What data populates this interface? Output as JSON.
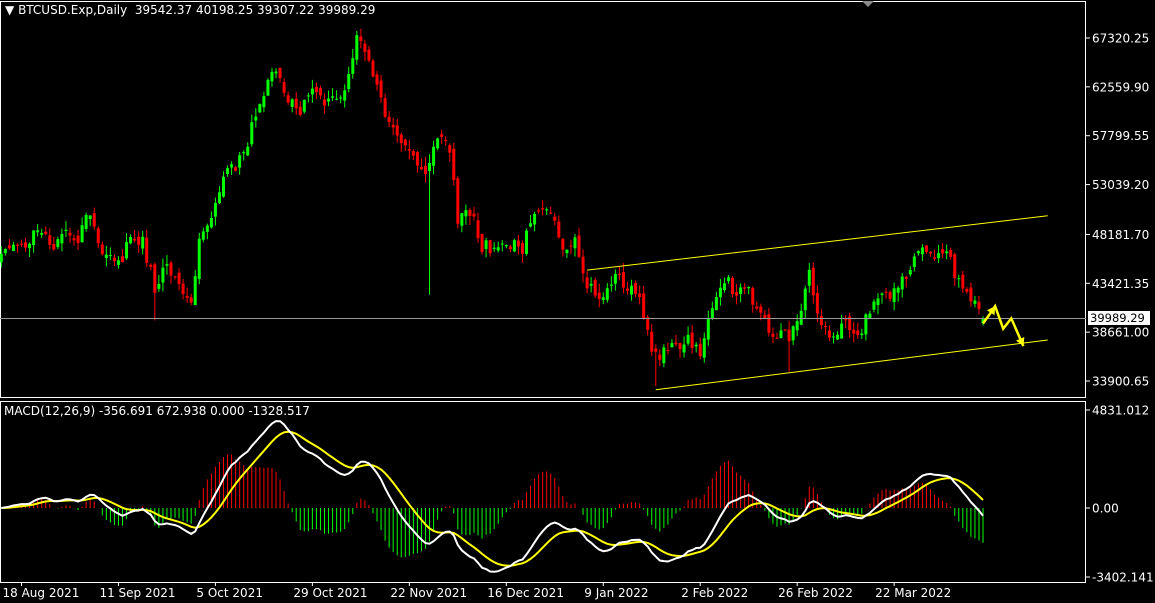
{
  "main_header": {
    "symbol": "BTCUSD.Exp,Daily",
    "ohlc": "39542.37 40198.25 39307.22 39989.29"
  },
  "macd_header": {
    "label": "MACD(12,26,9) -356.691 672.938 0.000 -1328.517"
  },
  "current_price": "39989.29",
  "colors": {
    "background": "#000000",
    "grid": "#ffffff",
    "bull": "#00ff00",
    "bear": "#ff0000",
    "channel": "#ffff00",
    "macd_line": "#ffffff",
    "signal_line": "#ffff00",
    "hist_pos": "#ff0000",
    "hist_neg": "#00ff00",
    "arrows": "#ffff00"
  },
  "icons": {
    "header_toggle": "triangle-down-icon"
  },
  "chart_data": [
    {
      "type": "candlestick",
      "title": "BTCUSD.Exp,Daily",
      "y_tick_labels": [
        "67320.25",
        "62559.90",
        "57799.55",
        "53039.20",
        "48181.70",
        "43421.35",
        "38661.00",
        "33900.65"
      ],
      "y_ticks": [
        67320.25,
        62559.9,
        57799.55,
        53039.2,
        48181.7,
        43421.35,
        38661.0,
        33900.65
      ],
      "x_tick_labels": [
        "18 Aug 2021",
        "11 Sep 2021",
        "5 Oct 2021",
        "29 Oct 2021",
        "22 Nov 2021",
        "16 Dec 2021",
        "9 Jan 2022",
        "2 Feb 2022",
        "26 Feb 2022",
        "22 Mar 2022"
      ],
      "x_ticks": [
        "2021-08-18",
        "2021-09-11",
        "2021-10-05",
        "2021-10-29",
        "2021-11-22",
        "2021-12-16",
        "2022-01-09",
        "2022-02-02",
        "2022-02-26",
        "2022-03-22"
      ],
      "ylim": [
        31700,
        71000
      ],
      "current_price": 39989.29,
      "close_anchors": [
        [
          "2021-08-13",
          46000
        ],
        [
          "2021-08-16",
          47000
        ],
        [
          "2021-08-19",
          46500
        ],
        [
          "2021-08-22",
          49000
        ],
        [
          "2021-08-26",
          47000
        ],
        [
          "2021-08-29",
          48800
        ],
        [
          "2021-09-01",
          48000
        ],
        [
          "2021-09-04",
          50500
        ],
        [
          "2021-09-07",
          46500
        ],
        [
          "2021-09-11",
          45400
        ],
        [
          "2021-09-14",
          47600
        ],
        [
          "2021-09-17",
          47500
        ],
        [
          "2021-09-20",
          43100
        ],
        [
          "2021-09-23",
          45000
        ],
        [
          "2021-09-26",
          42800
        ],
        [
          "2021-09-29",
          41500
        ],
        [
          "2021-10-01",
          47800
        ],
        [
          "2021-10-04",
          49300
        ],
        [
          "2021-10-07",
          53800
        ],
        [
          "2021-10-10",
          55000
        ],
        [
          "2021-10-13",
          57300
        ],
        [
          "2021-10-16",
          61500
        ],
        [
          "2021-10-20",
          64500
        ],
        [
          "2021-10-23",
          61000
        ],
        [
          "2021-10-26",
          60300
        ],
        [
          "2021-10-29",
          62200
        ],
        [
          "2021-11-01",
          61300
        ],
        [
          "2021-11-05",
          61200
        ],
        [
          "2021-11-09",
          67500
        ],
        [
          "2021-11-12",
          64500
        ],
        [
          "2021-11-16",
          60200
        ],
        [
          "2021-11-19",
          58100
        ],
        [
          "2021-11-22",
          56400
        ],
        [
          "2021-11-26",
          54500
        ],
        [
          "2021-11-29",
          57500
        ],
        [
          "2021-12-02",
          56500
        ],
        [
          "2021-12-04",
          49300
        ],
        [
          "2021-12-07",
          50600
        ],
        [
          "2021-12-10",
          47100
        ],
        [
          "2021-12-13",
          46800
        ],
        [
          "2021-12-16",
          47600
        ],
        [
          "2021-12-20",
          46700
        ],
        [
          "2021-12-23",
          50800
        ],
        [
          "2021-12-27",
          50600
        ],
        [
          "2021-12-30",
          47100
        ],
        [
          "2022-01-02",
          47300
        ],
        [
          "2022-01-05",
          43500
        ],
        [
          "2022-01-08",
          41700
        ],
        [
          "2022-01-12",
          43900
        ],
        [
          "2022-01-15",
          43100
        ],
        [
          "2022-01-18",
          42300
        ],
        [
          "2022-01-21",
          36400
        ],
        [
          "2022-01-24",
          36700
        ],
        [
          "2022-01-27",
          37300
        ],
        [
          "2022-01-30",
          37900
        ],
        [
          "2022-02-02",
          36900
        ],
        [
          "2022-02-05",
          41500
        ],
        [
          "2022-02-08",
          44000
        ],
        [
          "2022-02-11",
          42400
        ],
        [
          "2022-02-14",
          42500
        ],
        [
          "2022-02-17",
          40500
        ],
        [
          "2022-02-20",
          38400
        ],
        [
          "2022-02-24",
          38300
        ],
        [
          "2022-02-26",
          39200
        ],
        [
          "2022-03-01",
          44400
        ],
        [
          "2022-03-04",
          39100
        ],
        [
          "2022-03-07",
          38000
        ],
        [
          "2022-03-10",
          39400
        ],
        [
          "2022-03-13",
          37800
        ],
        [
          "2022-03-16",
          41100
        ],
        [
          "2022-03-19",
          42200
        ],
        [
          "2022-03-22",
          42400
        ],
        [
          "2022-03-26",
          44500
        ],
        [
          "2022-03-29",
          47500
        ],
        [
          "2022-04-01",
          45800
        ],
        [
          "2022-04-04",
          46600
        ],
        [
          "2022-04-07",
          43500
        ],
        [
          "2022-04-10",
          42200
        ],
        [
          "2022-04-13",
          40000
        ]
      ]
    },
    {
      "type": "macd",
      "label": "MACD(12,26,9) -356.691 672.938 0.000 -1328.517",
      "y_tick_labels": [
        "4831.012",
        "0.00",
        "-3402.141"
      ],
      "y_ticks": [
        4831.012,
        0,
        -3402.141
      ],
      "ylim": [
        -3402.141,
        4831.012
      ]
    }
  ]
}
